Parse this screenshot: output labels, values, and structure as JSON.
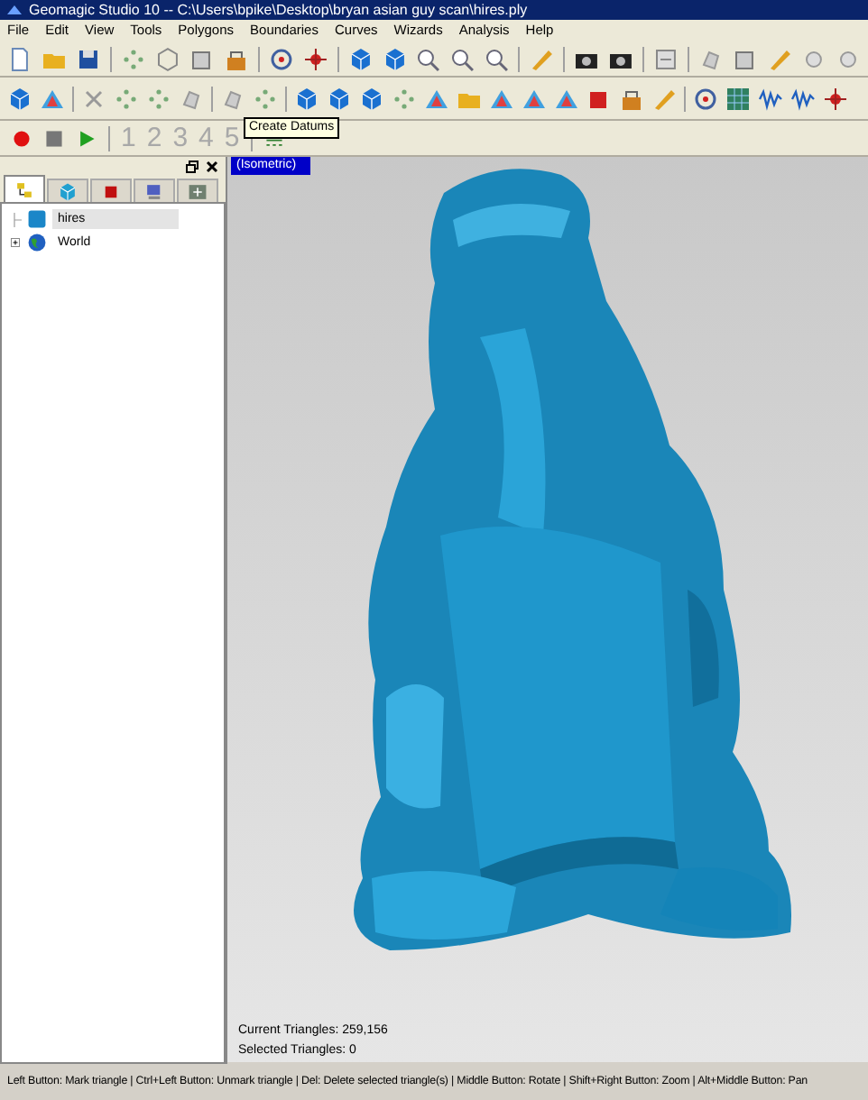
{
  "window": {
    "title": "Geomagic Studio 10 -- C:\\Users\\bpike\\Desktop\\bryan asian guy scan\\hires.ply"
  },
  "menu": [
    "File",
    "Edit",
    "View",
    "Tools",
    "Polygons",
    "Boundaries",
    "Curves",
    "Wizards",
    "Analysis",
    "Help"
  ],
  "macro_toolbar": {
    "steps": [
      "1",
      "2",
      "3",
      "4",
      "5"
    ]
  },
  "tooltip": "Create Datums",
  "panel_tabs": [
    {
      "selected": true
    },
    {
      "selected": false
    },
    {
      "selected": false
    },
    {
      "selected": false
    },
    {
      "selected": false
    }
  ],
  "tree": [
    {
      "label": "hires",
      "selected": true,
      "expandable": false
    },
    {
      "label": "World",
      "selected": false,
      "expandable": true
    }
  ],
  "viewport": {
    "view_label": "(Isometric)",
    "stats": [
      "Current Triangles: 259,156",
      "Selected Triangles: 0"
    ]
  },
  "status_bar": "Left Button: Mark triangle | Ctrl+Left Button: Unmark triangle | Del: Delete selected triangle(s) | Middle Button: Rotate | Shift+Right Button: Zoom | Alt+Middle Button: Pan"
}
